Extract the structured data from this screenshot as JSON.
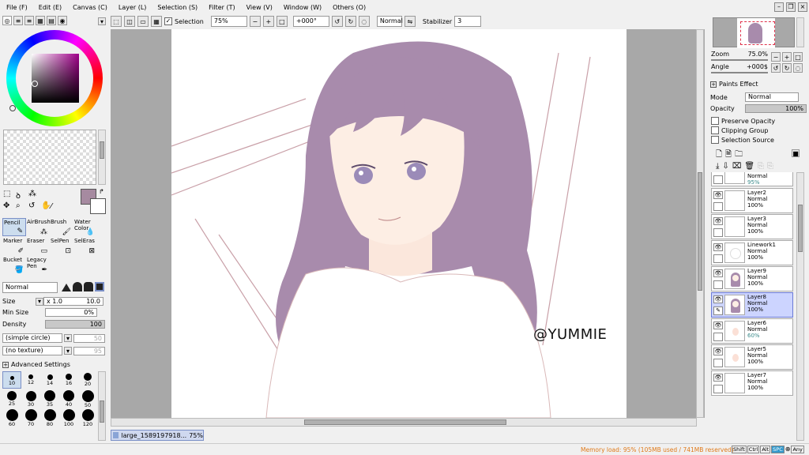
{
  "menubar": {
    "items": [
      "File (F)",
      "Edit (E)",
      "Canvas (C)",
      "Layer (L)",
      "Selection (S)",
      "Filter (T)",
      "View (V)",
      "Window (W)",
      "Others (O)"
    ]
  },
  "toolbar": {
    "selection_label": "Selection",
    "zoom_value": "75%",
    "angle_value": "+000°",
    "blend_value": "Normal",
    "stabilizer_label": "Stabilizer",
    "stabilizer_value": "3"
  },
  "tools": {
    "items": [
      {
        "label": "Pencil",
        "selected": true
      },
      {
        "label": "AirBrush",
        "selected": false
      },
      {
        "label": "Brush",
        "selected": false
      },
      {
        "label": "Water Color",
        "selected": false
      },
      {
        "label": "Marker",
        "selected": false
      },
      {
        "label": "Eraser",
        "selected": false
      },
      {
        "label": "SelPen",
        "selected": false
      },
      {
        "label": "SelEras",
        "selected": false
      },
      {
        "label": "Bucket",
        "selected": false
      },
      {
        "label": "Legacy Pen",
        "selected": false
      }
    ]
  },
  "brush_settings": {
    "blend_mode": "Normal",
    "size_label": "Size",
    "size_multiplier": "x 1.0",
    "size_value": "10.0",
    "min_size_label": "Min Size",
    "min_size_value": "0%",
    "density_label": "Density",
    "density_value": "100",
    "shape": "(simple circle)",
    "shape_value": "50",
    "texture": "(no texture)",
    "texture_value": "95",
    "advanced_label": "Advanced Settings",
    "brush_sizes": [
      "10",
      "12",
      "14",
      "16",
      "20",
      "25",
      "30",
      "35",
      "40",
      "50",
      "60",
      "70",
      "80",
      "100",
      "120"
    ]
  },
  "colors": {
    "current_color": "#a68aa0",
    "hue_indicator": "#800080"
  },
  "navigator": {
    "zoom_label": "Zoom",
    "zoom_value": "75.0%",
    "angle_label": "Angle",
    "angle_value": "+000$"
  },
  "paints_effect": {
    "title": "Paints Effect",
    "mode_label": "Mode",
    "mode_value": "Normal",
    "opacity_label": "Opacity",
    "opacity_value": "100%",
    "preserve_opacity": "Preserve Opacity",
    "clipping_group": "Clipping Group",
    "selection_source": "Selection Source"
  },
  "layers": {
    "partial_top": {
      "mode": "Normal",
      "opacity": "95%"
    },
    "items": [
      {
        "name": "Layer2",
        "mode": "Normal",
        "opacity": "100%",
        "selected": false
      },
      {
        "name": "Layer3",
        "mode": "Normal",
        "opacity": "100%",
        "selected": false
      },
      {
        "name": "Linework1",
        "mode": "Normal",
        "opacity": "100%",
        "selected": false
      },
      {
        "name": "Layer9",
        "mode": "Normal",
        "opacity": "100%",
        "selected": false
      },
      {
        "name": "Layer8",
        "mode": "Normal",
        "opacity": "100%",
        "selected": true
      },
      {
        "name": "Layer6",
        "mode": "Normal",
        "opacity": "60%",
        "selected": false
      },
      {
        "name": "Layer5",
        "mode": "Normal",
        "opacity": "100%",
        "selected": false
      },
      {
        "name": "Layer7",
        "mode": "Normal",
        "opacity": "100%",
        "selected": false
      }
    ]
  },
  "canvas": {
    "watermark": "@YUMMIE"
  },
  "taskbar": {
    "file_name": "large_1589197918...",
    "file_zoom": "75%"
  },
  "status": {
    "memory": "Memory load: 95% (105MB used / 741MB reserved)",
    "keys": [
      "Shift",
      "Ctrl",
      "Alt",
      "SPC",
      "Any"
    ]
  }
}
